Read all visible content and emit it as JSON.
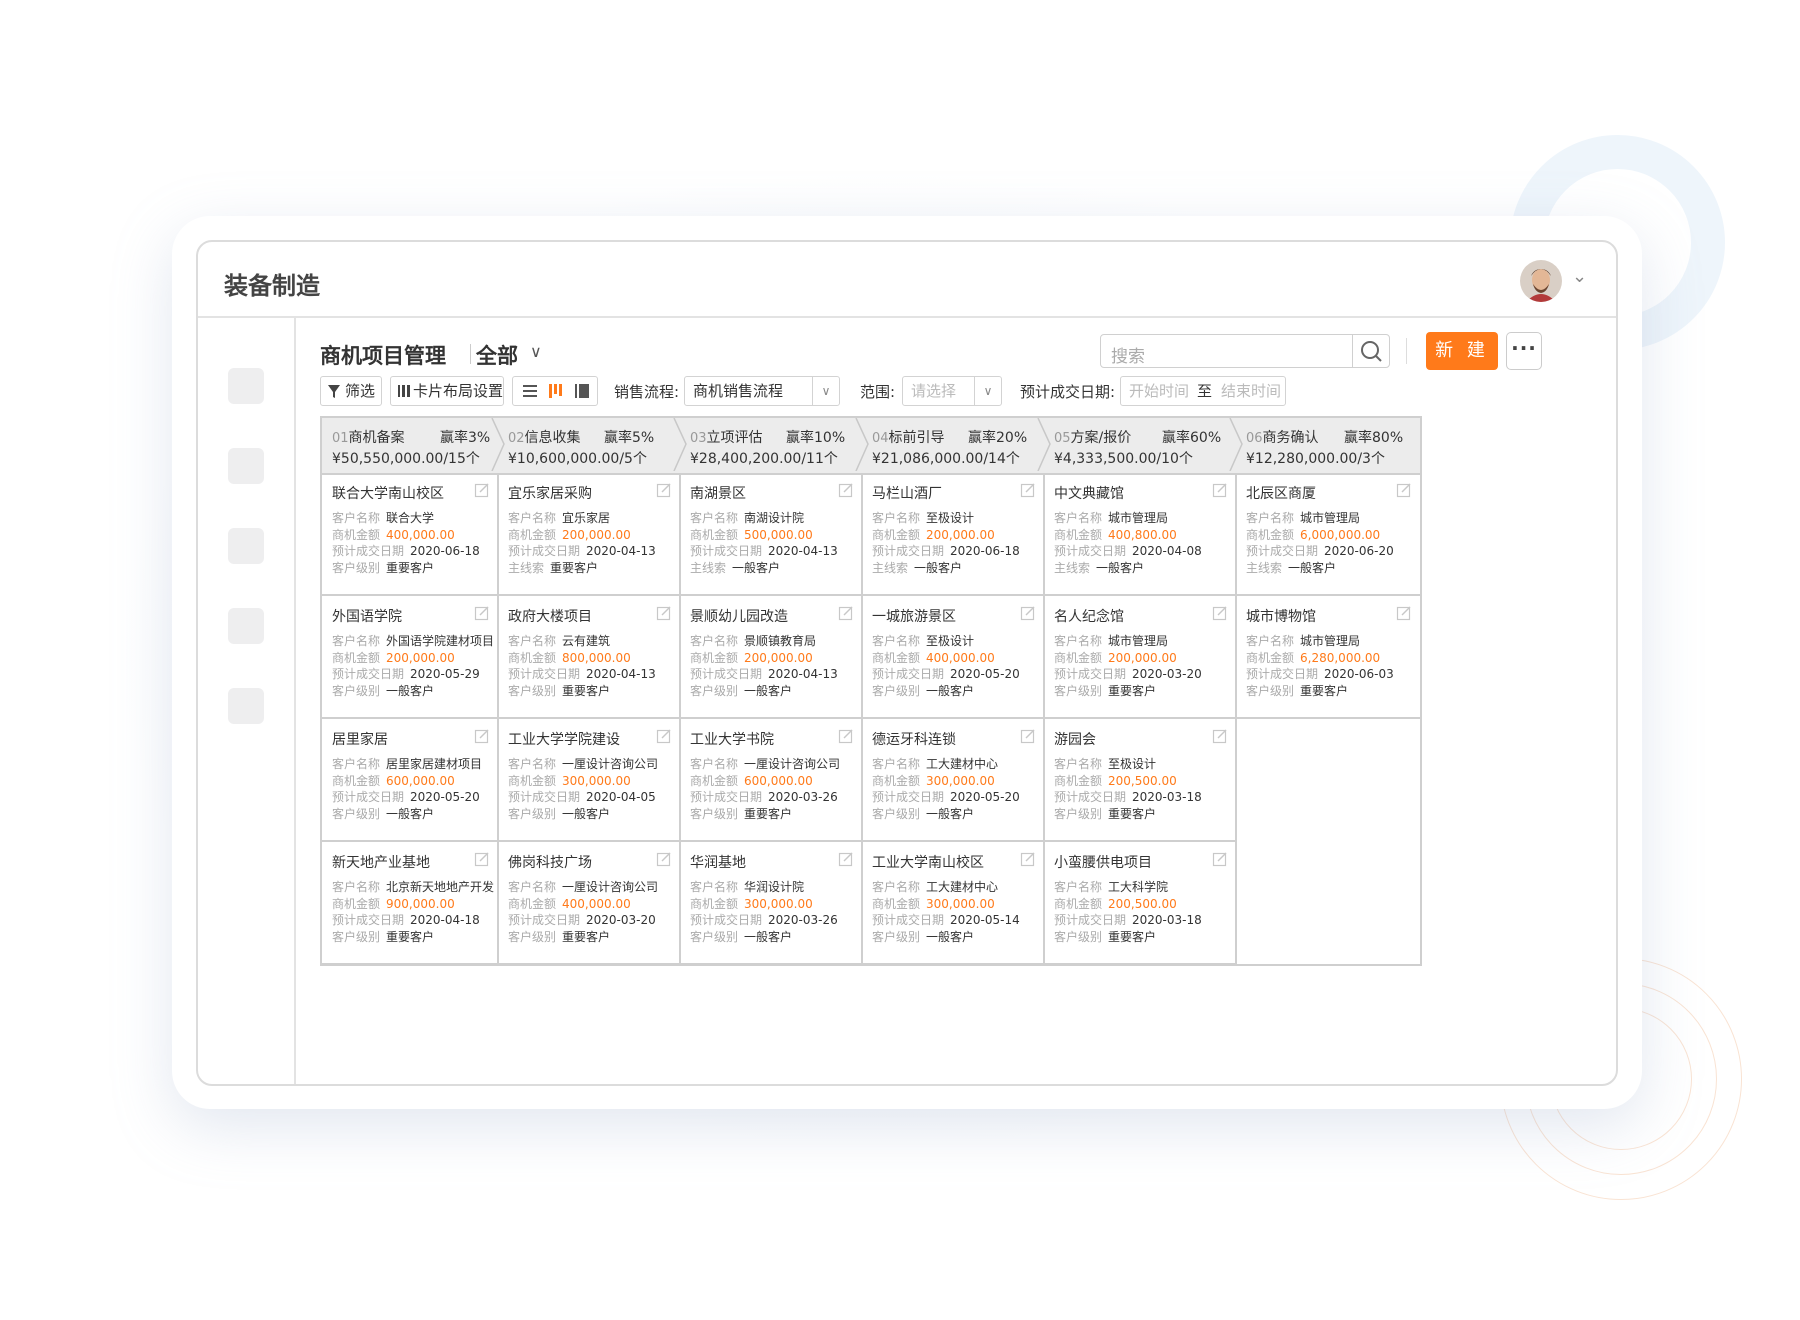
{
  "app": {
    "title": "装备制造"
  },
  "page": {
    "title": "商机项目管理",
    "scope": "全部"
  },
  "search": {
    "placeholder": "搜索"
  },
  "actions": {
    "new_label": "新 建"
  },
  "toolbar": {
    "filter_label": "筛选",
    "card_layout_label": "卡片布局设置",
    "process_label": "销售流程:",
    "process_value": "商机销售流程",
    "range_label": "范围:",
    "range_placeholder": "请选择",
    "date_label": "预计成交日期:",
    "date_start_placeholder": "开始时间",
    "date_to": "至",
    "date_end_placeholder": "结束时间"
  },
  "colors": {
    "accent": "#ff7a1a",
    "border": "#cfcfcf",
    "header_bg": "#ececec"
  },
  "field_labels": {
    "customer": "客户名称",
    "amount": "商机金额",
    "date": "预计成交日期",
    "level": "客户级别",
    "lead": "主线索"
  },
  "stages": [
    {
      "no": "01",
      "name": "商机备案",
      "rate": "赢率3%",
      "summary": "¥50,550,000.00/15个",
      "cards": [
        {
          "title": "联合大学南山校区",
          "customer": "联合大学",
          "amount": "400,000.00",
          "date": "2020-06-18",
          "l4": "客户级别",
          "v4": "重要客户"
        },
        {
          "title": "外国语学院",
          "customer": "外国语学院建材项目",
          "amount": "200,000.00",
          "date": "2020-05-29",
          "l4": "客户级别",
          "v4": "一般客户"
        },
        {
          "title": "居里家居",
          "customer": "居里家居建材项目",
          "amount": "600,000.00",
          "date": "2020-05-20",
          "l4": "客户级别",
          "v4": "一般客户"
        },
        {
          "title": "新天地产业基地",
          "customer": "北京新天地地产开发",
          "amount": "900,000.00",
          "date": "2020-04-18",
          "l4": "客户级别",
          "v4": "重要客户"
        }
      ]
    },
    {
      "no": "02",
      "name": "信息收集",
      "rate": "赢率5%",
      "summary": "¥10,600,000.00/5个",
      "cards": [
        {
          "title": "宜乐家居采购",
          "customer": "宜乐家居",
          "amount": "200,000.00",
          "date": "2020-04-13",
          "l4": "主线索",
          "v4": "重要客户"
        },
        {
          "title": "政府大楼项目",
          "customer": "云有建筑",
          "amount": "800,000.00",
          "date": "2020-04-13",
          "l4": "客户级别",
          "v4": "重要客户"
        },
        {
          "title": "工业大学学院建设",
          "customer": "一厘设计咨询公司",
          "amount": "300,000.00",
          "date": "2020-04-05",
          "l4": "客户级别",
          "v4": "一般客户"
        },
        {
          "title": "佛岗科技广场",
          "customer": "一厘设计咨询公司",
          "amount": "400,000.00",
          "date": "2020-03-20",
          "l4": "客户级别",
          "v4": "重要客户"
        }
      ]
    },
    {
      "no": "03",
      "name": "立项评估",
      "rate": "赢率10%",
      "summary": "¥28,400,200.00/11个",
      "cards": [
        {
          "title": "南湖景区",
          "customer": "南湖设计院",
          "amount": "500,000.00",
          "date": "2020-04-13",
          "l4": "主线索",
          "v4": "一般客户"
        },
        {
          "title": "景顺幼儿园改造",
          "customer": "景顺镇教育局",
          "amount": "200,000.00",
          "date": "2020-04-13",
          "l4": "客户级别",
          "v4": "一般客户"
        },
        {
          "title": "工业大学书院",
          "customer": "一厘设计咨询公司",
          "amount": "600,000.00",
          "date": "2020-03-26",
          "l4": "客户级别",
          "v4": "重要客户"
        },
        {
          "title": "华润基地",
          "customer": "华润设计院",
          "amount": "300,000.00",
          "date": "2020-03-26",
          "l4": "客户级别",
          "v4": "一般客户"
        }
      ]
    },
    {
      "no": "04",
      "name": "标前引导",
      "rate": "赢率20%",
      "summary": "¥21,086,000.00/14个",
      "cards": [
        {
          "title": "马栏山酒厂",
          "customer": "至极设计",
          "amount": "200,000.00",
          "date": "2020-06-18",
          "l4": "主线索",
          "v4": "一般客户"
        },
        {
          "title": "一城旅游景区",
          "customer": "至极设计",
          "amount": "400,000.00",
          "date": "2020-05-20",
          "l4": "客户级别",
          "v4": "一般客户"
        },
        {
          "title": "德运牙科连锁",
          "customer": "工大建材中心",
          "amount": "300,000.00",
          "date": "2020-05-20",
          "l4": "客户级别",
          "v4": "一般客户"
        },
        {
          "title": "工业大学南山校区",
          "customer": "工大建材中心",
          "amount": "300,000.00",
          "date": "2020-05-14",
          "l4": "客户级别",
          "v4": "一般客户"
        }
      ]
    },
    {
      "no": "05",
      "name": "方案/报价",
      "rate": "赢率60%",
      "summary": "¥4,333,500.00/10个",
      "cards": [
        {
          "title": "中文典藏馆",
          "customer": "城市管理局",
          "amount": "400,800.00",
          "date": "2020-04-08",
          "l4": "主线索",
          "v4": "一般客户"
        },
        {
          "title": "名人纪念馆",
          "customer": "城市管理局",
          "amount": "200,000.00",
          "date": "2020-03-20",
          "l4": "客户级别",
          "v4": "重要客户"
        },
        {
          "title": "游园会",
          "customer": "至极设计",
          "amount": "200,500.00",
          "date": "2020-03-18",
          "l4": "客户级别",
          "v4": "重要客户"
        },
        {
          "title": "小蛮腰供电项目",
          "customer": "工大科学院",
          "amount": "200,500.00",
          "date": "2020-03-18",
          "l4": "客户级别",
          "v4": "重要客户"
        }
      ]
    },
    {
      "no": "06",
      "name": "商务确认",
      "rate": "赢率80%",
      "summary": "¥12,280,000.00/3个",
      "cards": [
        {
          "title": "北辰区商厦",
          "customer": "城市管理局",
          "amount": "6,000,000.00",
          "date": "2020-06-20",
          "l4": "主线索",
          "v4": "一般客户"
        },
        {
          "title": "城市博物馆",
          "customer": "城市管理局",
          "amount": "6,280,000.00",
          "date": "2020-06-03",
          "l4": "客户级别",
          "v4": "重要客户"
        }
      ]
    }
  ]
}
